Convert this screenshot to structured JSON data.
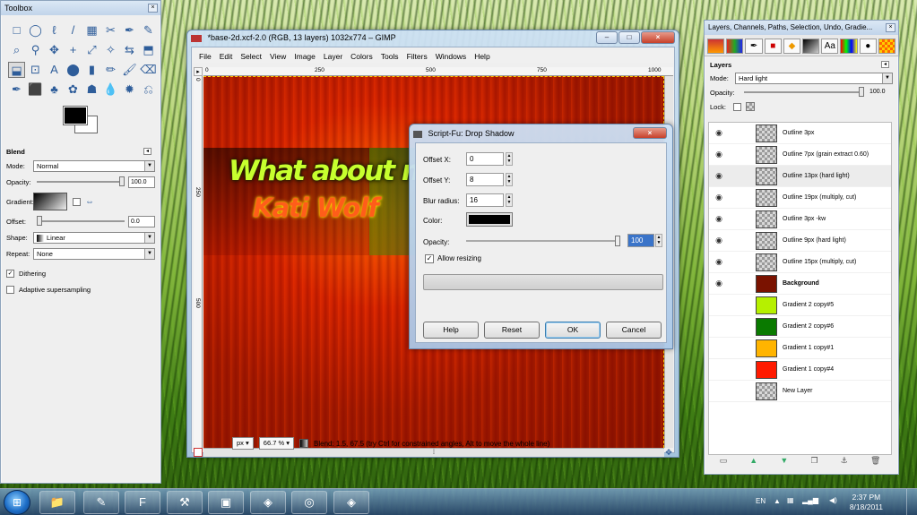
{
  "toolbox": {
    "title": "Toolbox",
    "tools": [
      "□",
      "◯",
      "ℓ",
      "/",
      "▦",
      "✂",
      "✒",
      "✎",
      "⌕",
      "⚲",
      "✥",
      "+",
      "⤢",
      "✧",
      "⇆",
      "⬒",
      "⬓",
      "⊡",
      "A",
      "⬤",
      "▮",
      "✏",
      "🖌",
      "⌫",
      "✒",
      "⬛",
      "♣",
      "✿",
      "☗",
      "💧",
      "✹",
      "⎌"
    ],
    "blend": {
      "header": "Blend",
      "mode_label": "Mode:",
      "mode_value": "Normal",
      "opacity_label": "Opacity:",
      "opacity_value": "100.0",
      "opacity_level": 1.0,
      "gradient_label": "Gradient:",
      "offset_label": "Offset:",
      "offset_value": "0.0",
      "offset_level": 0.0,
      "shape_label": "Shape:",
      "shape_value": "Linear",
      "repeat_label": "Repeat:",
      "repeat_value": "None",
      "dithering_label": "Dithering",
      "dithering_checked": true,
      "adaptive_label": "Adaptive supersampling",
      "adaptive_checked": false
    }
  },
  "image_window": {
    "title": "*base-2d.xcf-2.0 (RGB, 13 layers) 1032x774 – GIMP",
    "menu": [
      "File",
      "Edit",
      "Select",
      "View",
      "Image",
      "Layer",
      "Colors",
      "Tools",
      "Filters",
      "Windows",
      "Help"
    ],
    "ruler_top": [
      "0",
      "250",
      "500",
      "750",
      "1000"
    ],
    "ruler_left": [
      "0",
      "250",
      "500"
    ],
    "artwork_headline": "What about my",
    "artwork_subline": "Kati Wolf",
    "unit": "px",
    "zoom": "66.7 %",
    "status": "Blend: 1.5, 67.5 (try Ctrl for constrained angles, Alt to move the whole line)"
  },
  "dialog": {
    "title": "Script-Fu: Drop Shadow",
    "offset_x_label": "Offset X:",
    "offset_x_value": "0",
    "offset_y_label": "Offset Y:",
    "offset_y_value": "8",
    "blur_label": "Blur radius:",
    "blur_value": "16",
    "color_label": "Color:",
    "color_value": "#000000",
    "opacity_label": "Opacity:",
    "opacity_value": "100",
    "opacity_level": 1.0,
    "allow_resizing_label": "Allow resizing",
    "allow_resizing_checked": true,
    "help_label": "Help",
    "reset_label": "Reset",
    "ok_label": "OK",
    "cancel_label": "Cancel"
  },
  "layers_dock": {
    "title": "Layers, Channels, Paths, Selection, Undo, Gradie...",
    "panel_label": "Layers",
    "mode_label": "Mode:",
    "mode_value": "Hard light",
    "opacity_label": "Opacity:",
    "opacity_value": "100.0",
    "lock_label": "Lock:",
    "layers": [
      {
        "name": "Outline 3px",
        "visible": true,
        "thumb": "checker"
      },
      {
        "name": "Outline 7px (grain extract 0.60)",
        "visible": true,
        "thumb": "checker"
      },
      {
        "name": "Outline 13px (hard light)",
        "visible": true,
        "thumb": "checker"
      },
      {
        "name": "Outline 19px (multiply, cut)",
        "visible": true,
        "thumb": "checker"
      },
      {
        "name": "Outline 3px -kw",
        "visible": true,
        "thumb": "checker"
      },
      {
        "name": "Outline 9px (hard light)",
        "visible": true,
        "thumb": "checker"
      },
      {
        "name": "Outline 15px (multiply, cut)",
        "visible": true,
        "thumb": "checker"
      },
      {
        "name": "Background",
        "visible": true,
        "thumb": "#7a1200"
      },
      {
        "name": "Gradient 2 copy#5",
        "visible": false,
        "thumb": "#b6f000"
      },
      {
        "name": "Gradient 2 copy#6",
        "visible": false,
        "thumb": "#0a7a00"
      },
      {
        "name": "Gradient 1 copy#1",
        "visible": false,
        "thumb": "#ffb400"
      },
      {
        "name": "Gradient 1 copy#4",
        "visible": false,
        "thumb": "#ff1a00"
      },
      {
        "name": "New Layer",
        "visible": false,
        "thumb": "checker"
      }
    ]
  },
  "taskbar": {
    "lang": "EN",
    "time": "2:37 PM",
    "date": "8/18/2011"
  }
}
